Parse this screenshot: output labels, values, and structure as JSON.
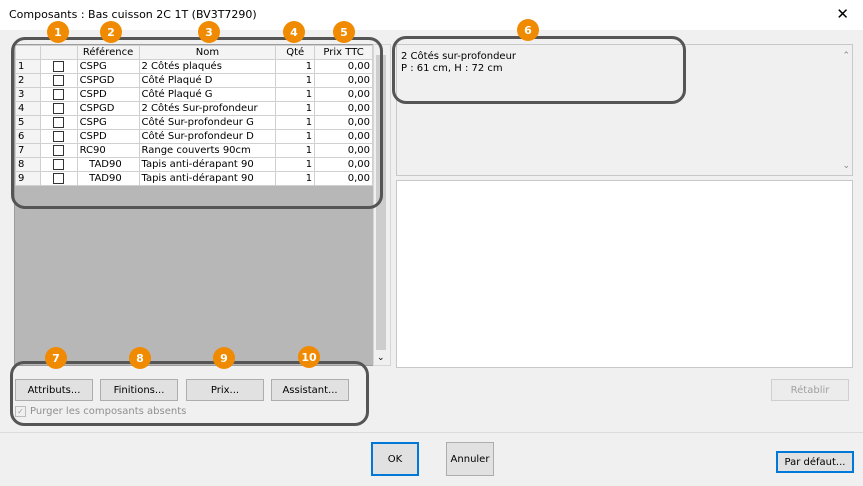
{
  "window": {
    "title": "Composants : Bas cuisson 2C 1T (BV3T7290)",
    "close_glyph": "✕"
  },
  "table": {
    "headers": {
      "reference": "Référence",
      "nom": "Nom",
      "qte": "Qté",
      "prix": "Prix TTC"
    },
    "rows": [
      {
        "n": "1",
        "ref": "CSPG",
        "nom": "2 Côtés plaqués",
        "qte": "1",
        "prix": "0,00"
      },
      {
        "n": "2",
        "ref": "CSPGD",
        "nom": "Côté Plaqué D",
        "qte": "1",
        "prix": "0,00"
      },
      {
        "n": "3",
        "ref": "CSPD",
        "nom": "Côté Plaqué G",
        "qte": "1",
        "prix": "0,00"
      },
      {
        "n": "4",
        "ref": "CSPGD",
        "nom": "2 Côtés Sur-profondeur",
        "qte": "1",
        "prix": "0,00"
      },
      {
        "n": "5",
        "ref": "CSPG",
        "nom": "Côté Sur-profondeur G",
        "qte": "1",
        "prix": "0,00"
      },
      {
        "n": "6",
        "ref": "CSPD",
        "nom": "Côté Sur-profondeur D",
        "qte": "1",
        "prix": "0,00"
      },
      {
        "n": "7",
        "ref": "RC90",
        "nom": "Range couverts 90cm",
        "qte": "1",
        "prix": "0,00"
      },
      {
        "n": "8",
        "ref": "TAD90",
        "nom": "Tapis anti-dérapant 90",
        "qte": "1",
        "prix": "0,00"
      },
      {
        "n": "9",
        "ref": "TAD90",
        "nom": "Tapis anti-dérapant 90",
        "qte": "1",
        "prix": "0,00"
      }
    ]
  },
  "info": {
    "line1": "2 Côtés sur-profondeur",
    "line2": "P : 61 cm, H : 72 cm"
  },
  "buttons": {
    "attributs": "Attributs...",
    "finitions": "Finitions...",
    "prix": "Prix...",
    "assistant": "Assistant...",
    "retablir": "Rétablir",
    "ok": "OK",
    "annuler": "Annuler",
    "par_defaut": "Par défaut..."
  },
  "purge": {
    "label": "Purger les composants absents",
    "checked": true
  },
  "badges": [
    "1",
    "2",
    "3",
    "4",
    "5",
    "6",
    "7",
    "8",
    "9",
    "10"
  ],
  "colors": {
    "badge": "#f08a00",
    "highlight": "#555555"
  }
}
